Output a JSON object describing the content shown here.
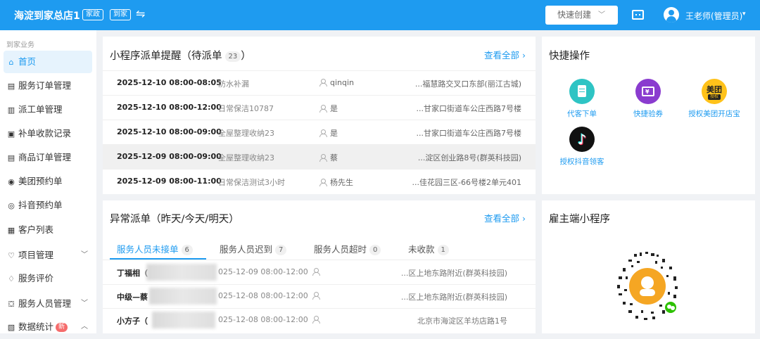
{
  "header": {
    "store_name": "海淀到家总店1",
    "tags": [
      "家政",
      "到家"
    ],
    "quick_create": "快速创建",
    "user_name": "王老师(管理员)"
  },
  "sidebar": {
    "section_title": "到家业务",
    "items": [
      {
        "label": "首页",
        "icon": "home-icon",
        "active": true
      },
      {
        "label": "服务订单管理",
        "icon": "document-icon"
      },
      {
        "label": "派工单管理",
        "icon": "clipboard-icon"
      },
      {
        "label": "补单收款记录",
        "icon": "receipt-icon"
      },
      {
        "label": "商品订单管理",
        "icon": "order-icon"
      },
      {
        "label": "美团预约单",
        "icon": "meituan-icon"
      },
      {
        "label": "抖音预约单",
        "icon": "douyin-icon"
      },
      {
        "label": "客户列表",
        "icon": "customer-icon"
      },
      {
        "label": "项目管理",
        "icon": "heart-icon",
        "expandable": true
      },
      {
        "label": "服务评价",
        "icon": "rating-icon"
      },
      {
        "label": "服务人员管理",
        "icon": "staff-icon",
        "expandable": true
      },
      {
        "label": "数据统计",
        "icon": "stats-icon",
        "badge": "新",
        "expandable": true
      }
    ]
  },
  "dispatch_panel": {
    "title": "小程序派单提醒（待派单",
    "count": "23",
    "title_suffix": "）",
    "view_all": "查看全部",
    "rows": [
      {
        "time": "2025-12-10 08:00-08:05",
        "service": "防水补漏",
        "user": "qinqin",
        "address": "...福慧路交叉口东部(丽江古城)"
      },
      {
        "time": "2025-12-10 08:00-12:00",
        "service": "日常保洁10787",
        "user": "是",
        "address": "...甘家口街道车公庄西路7号楼"
      },
      {
        "time": "2025-12-10 08:00-09:00",
        "service": "全屋整理收纳23",
        "user": "是",
        "address": "...甘家口街道车公庄西路7号楼"
      },
      {
        "time": "2025-12-09 08:00-09:00",
        "service": "全屋整理收纳23",
        "user": "蔡",
        "address": "...淀区创业路8号(群英科技园)",
        "highlight": true
      },
      {
        "time": "2025-12-09 08:00-11:00",
        "service": "日常保洁测试3小时",
        "user": "杨先生",
        "address": "...佳花园三区-66号楼2单元401"
      }
    ]
  },
  "abnormal_panel": {
    "title": "异常派单（昨天/今天/明天）",
    "view_all": "查看全部",
    "tabs": [
      {
        "label": "服务人员未接单",
        "count": "6",
        "active": true
      },
      {
        "label": "服务人员迟到",
        "count": "7"
      },
      {
        "label": "服务人员超时",
        "count": "0"
      },
      {
        "label": "未收款",
        "count": "1"
      }
    ],
    "rows": [
      {
        "name": "丁福相（",
        "time": "025-12-09 08:00-12:00",
        "address": "...区上地东路附近(群英科技园)"
      },
      {
        "name": "中级—蔡",
        "time": "025-12-08 08:00-12:00",
        "address": "...区上地东路附近(群英科技园)"
      },
      {
        "name": "小方子（",
        "time": "025-12-08 08:00-12:00",
        "address": "北京市海淀区羊坊店路1号"
      }
    ]
  },
  "quick_ops": {
    "title": "快捷操作",
    "items": [
      {
        "label": "代客下单",
        "icon": "clipboard-icon",
        "color": "#2ec4c4"
      },
      {
        "label": "快捷验券",
        "icon": "ticket-icon",
        "color": "#8a3ccf"
      },
      {
        "label": "授权美团开店宝",
        "icon": "meituan-logo-icon",
        "color": "#ffc21a",
        "logo_text": "美团",
        "logo_sub": "授权"
      },
      {
        "label": "授权抖音领客",
        "icon": "tiktok-logo-icon",
        "color": "#111111"
      }
    ]
  },
  "miniprogram": {
    "title": "雇主端小程序"
  }
}
